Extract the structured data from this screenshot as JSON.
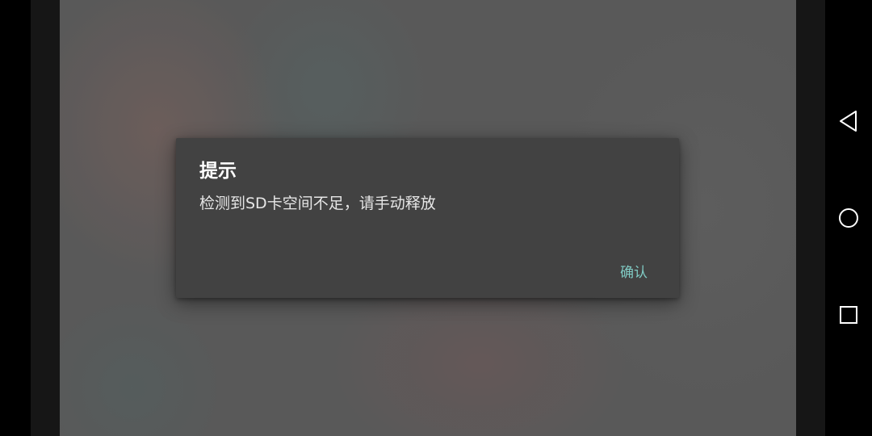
{
  "dialog": {
    "title": "提示",
    "message": "检测到SD卡空间不足，请手动释放",
    "confirm_label": "确认",
    "accent_color": "#80cbc4",
    "background_color": "#424242"
  },
  "navbar": {
    "back_icon": "back-triangle-icon",
    "home_icon": "home-circle-icon",
    "recents_icon": "recents-square-icon"
  }
}
